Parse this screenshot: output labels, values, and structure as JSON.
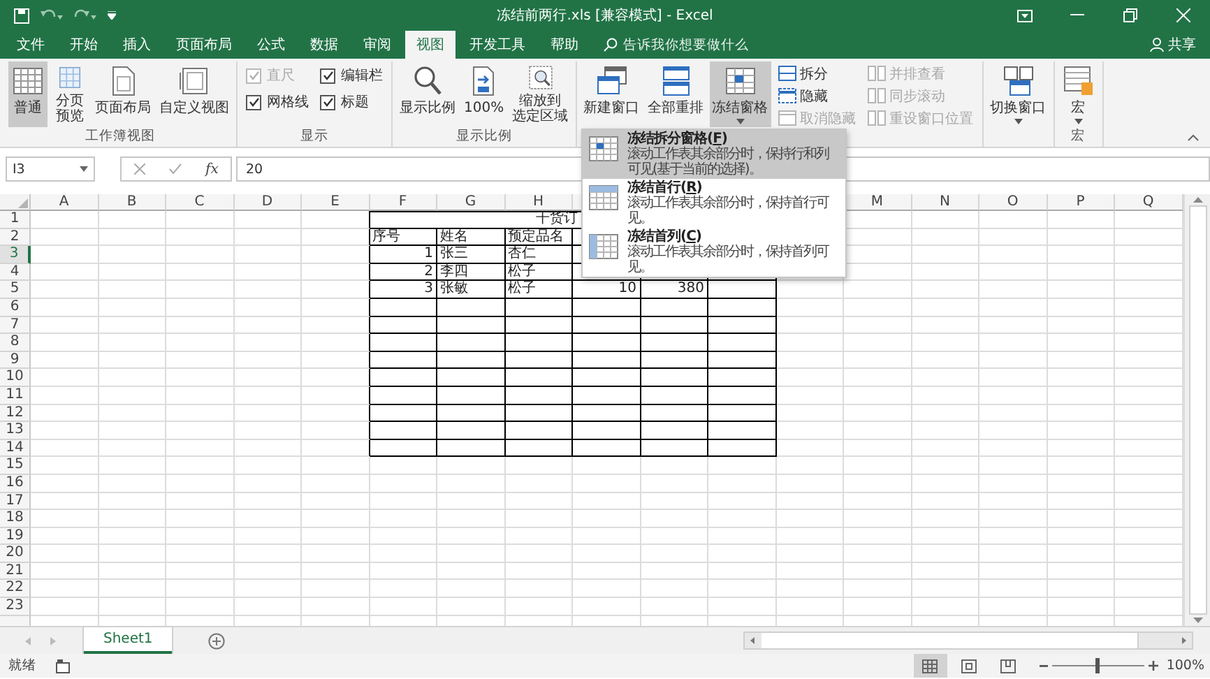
{
  "window": {
    "title": "冻结前两行.xls  [兼容模式]  -  Excel"
  },
  "tabs": [
    {
      "label": "文件",
      "selected": false
    },
    {
      "label": "开始",
      "selected": false
    },
    {
      "label": "插入",
      "selected": false
    },
    {
      "label": "页面布局",
      "selected": false
    },
    {
      "label": "公式",
      "selected": false
    },
    {
      "label": "数据",
      "selected": false
    },
    {
      "label": "审阅",
      "selected": false
    },
    {
      "label": "视图",
      "selected": true
    },
    {
      "label": "开发工具",
      "selected": false
    },
    {
      "label": "帮助",
      "selected": false
    }
  ],
  "search": {
    "placeholder": "告诉我你想要做什么"
  },
  "share": "共享",
  "ribbon": {
    "groups": [
      {
        "label": "工作簿视图",
        "items": [
          {
            "kind": "large",
            "lines": [
              "普通"
            ],
            "selected": true
          },
          {
            "kind": "large",
            "lines": [
              "分页",
              "预览"
            ],
            "selected": false
          },
          {
            "kind": "large",
            "lines": [
              "页面布局"
            ],
            "selected": false
          },
          {
            "kind": "large",
            "lines": [
              "自定义视图"
            ],
            "selected": false
          }
        ]
      },
      {
        "label": "显示",
        "items": [
          {
            "kind": "stack",
            "items": [
              {
                "kind": "check",
                "label": "直尺",
                "checked": true,
                "disabled": true
              },
              {
                "kind": "check",
                "label": "网格线",
                "checked": true,
                "disabled": false
              }
            ]
          },
          {
            "kind": "stack",
            "items": [
              {
                "kind": "check",
                "label": "编辑栏",
                "checked": true,
                "disabled": false
              },
              {
                "kind": "check",
                "label": "标题",
                "checked": true,
                "disabled": false
              }
            ]
          }
        ]
      },
      {
        "label": "显示比例",
        "items": [
          {
            "kind": "large",
            "lines": [
              "显示比例"
            ],
            "selected": false
          },
          {
            "kind": "large",
            "lines": [
              "100%"
            ],
            "selected": false
          },
          {
            "kind": "large",
            "lines": [
              "缩放到",
              "选定区域"
            ],
            "selected": false
          }
        ]
      },
      {
        "items": [
          {
            "kind": "large",
            "lines": [
              "新建窗口"
            ],
            "selected": false
          },
          {
            "kind": "large",
            "lines": [
              "全部重排"
            ],
            "selected": false
          },
          {
            "kind": "large",
            "lines": [
              "冻结窗格"
            ],
            "selected": true,
            "dropdown": true
          },
          {
            "kind": "stack",
            "items": [
              {
                "kind": "small",
                "label": "拆分",
                "disabled": false
              },
              {
                "kind": "small",
                "label": "隐藏",
                "disabled": false
              },
              {
                "kind": "small",
                "label": "取消隐藏",
                "disabled": true
              }
            ]
          },
          {
            "kind": "stack",
            "items": [
              {
                "kind": "small",
                "label": "并排查看",
                "disabled": true
              },
              {
                "kind": "small",
                "label": "同步滚动",
                "disabled": true
              },
              {
                "kind": "small",
                "label": "重设窗口位置",
                "disabled": true
              }
            ]
          }
        ]
      },
      {
        "items": [
          {
            "kind": "large",
            "lines": [
              "切换窗口"
            ],
            "selected": false,
            "dropdown": true
          }
        ]
      },
      {
        "label": "宏",
        "items": [
          {
            "kind": "large",
            "lines": [
              "宏"
            ],
            "selected": false,
            "dropdown": true
          }
        ]
      }
    ]
  },
  "menu": {
    "items": [
      {
        "title_before": "冻结拆分窗格(",
        "key": "F",
        "title_after": ")",
        "description": "滚动工作表其余部分时，保持行和列可见(基于当前的选择)。",
        "selected": true
      },
      {
        "title_before": "冻结首行(",
        "key": "R",
        "title_after": ")",
        "description": "滚动工作表其余部分时，保持首行可见。",
        "selected": false
      },
      {
        "title_before": "冻结首列(",
        "key": "C",
        "title_after": ")",
        "description": "滚动工作表其余部分时，保持首列可见。",
        "selected": false
      }
    ]
  },
  "formula_bar": {
    "name_box": "I3",
    "function_label": "fx",
    "value": "20"
  },
  "sheet": {
    "columns": [
      {
        "label": "A"
      },
      {
        "label": "B"
      },
      {
        "label": "C"
      },
      {
        "label": "D"
      },
      {
        "label": "E"
      },
      {
        "label": "F"
      },
      {
        "label": "G"
      },
      {
        "label": "H"
      },
      {},
      {},
      {},
      {},
      {
        "label": "M"
      },
      {
        "label": "N"
      },
      {
        "label": "O"
      },
      {
        "label": "P"
      },
      {
        "label": "Q"
      }
    ],
    "rows": [
      {
        "label": "1",
        "selected": false
      },
      {
        "label": "2",
        "selected": false
      },
      {
        "label": "3",
        "selected": true
      },
      {
        "label": "4",
        "selected": false
      },
      {
        "label": "5",
        "selected": false
      },
      {
        "label": "6",
        "selected": false
      },
      {
        "label": "7",
        "selected": false
      },
      {
        "label": "8",
        "selected": false
      },
      {
        "label": "9",
        "selected": false
      },
      {
        "label": "10",
        "selected": false
      },
      {
        "label": "11",
        "selected": false
      },
      {
        "label": "12",
        "selected": false
      },
      {
        "label": "13",
        "selected": false
      },
      {
        "label": "14",
        "selected": false
      },
      {
        "label": "15",
        "selected": false
      },
      {
        "label": "16",
        "selected": false
      },
      {
        "label": "17",
        "selected": false
      },
      {
        "label": "18",
        "selected": false
      },
      {
        "label": "19",
        "selected": false
      },
      {
        "label": "20",
        "selected": false
      },
      {
        "label": "21",
        "selected": false
      },
      {
        "label": "22",
        "selected": false
      },
      {
        "label": "23",
        "selected": false
      }
    ],
    "table": {
      "title": "干货订",
      "header": [
        "序号",
        "姓名",
        "预定品名"
      ],
      "body": [
        [
          {
            "text": "1",
            "kind": "number"
          },
          {
            "text": "张三",
            "kind": "text"
          },
          {
            "text": "杏仁",
            "kind": "text"
          }
        ],
        [
          {
            "text": "2",
            "kind": "number"
          },
          {
            "text": "李四",
            "kind": "text"
          },
          {
            "text": "松子",
            "kind": "text"
          }
        ],
        [
          {
            "text": "3",
            "kind": "number"
          },
          {
            "text": "张敏",
            "kind": "text"
          },
          {
            "text": "松子",
            "kind": "text"
          },
          {
            "text": "10",
            "kind": "number"
          },
          {
            "text": "380",
            "kind": "number"
          }
        ]
      ]
    }
  },
  "sheet_tabs": [
    {
      "label": "Sheet1",
      "selected": true
    }
  ],
  "status": {
    "text": "就绪",
    "views": [
      {
        "selected": true
      },
      {
        "selected": false
      },
      {
        "selected": false
      }
    ],
    "zoom": {
      "level": 0.5,
      "reading": "100%"
    }
  }
}
